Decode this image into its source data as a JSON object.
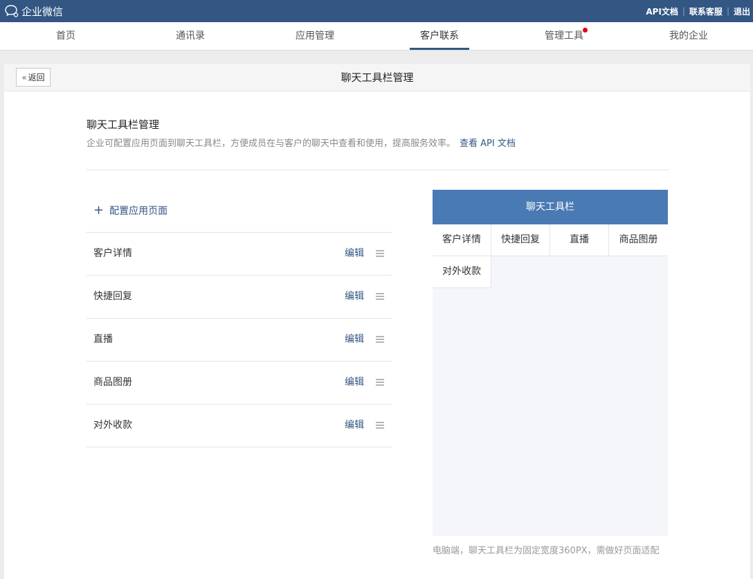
{
  "topbar": {
    "brand_name": "企业微信",
    "links": [
      "API文档",
      "联系客服",
      "退出"
    ]
  },
  "nav": {
    "items": [
      "首页",
      "通讯录",
      "应用管理",
      "客户联系",
      "管理工具",
      "我的企业"
    ],
    "active": "客户联系",
    "badge_item": "管理工具",
    "badge_color": "#e4000f"
  },
  "page": {
    "back_label": "返回",
    "title": "聊天工具栏管理"
  },
  "section": {
    "title": "聊天工具栏管理",
    "desc": "企业可配置应用页面到聊天工具栏，方便成员在与客户的聊天中查看和使用，提高服务效率。",
    "doc_link": "查看 API 文档"
  },
  "config": {
    "add_label": "配置应用页面",
    "edit_label": "编辑",
    "items": [
      "客户详情",
      "快捷回复",
      "直播",
      "商品图册",
      "对外收款"
    ]
  },
  "preview": {
    "header": "聊天工具栏",
    "cells": [
      "客户详情",
      "快捷回复",
      "直播",
      "商品图册",
      "对外收款"
    ],
    "note": "电脑端，聊天工具栏为固定宽度360PX，需做好页面适配"
  },
  "colors": {
    "topbar": "#335683",
    "accent": "#335683",
    "preview_header": "#4a7ab4"
  }
}
